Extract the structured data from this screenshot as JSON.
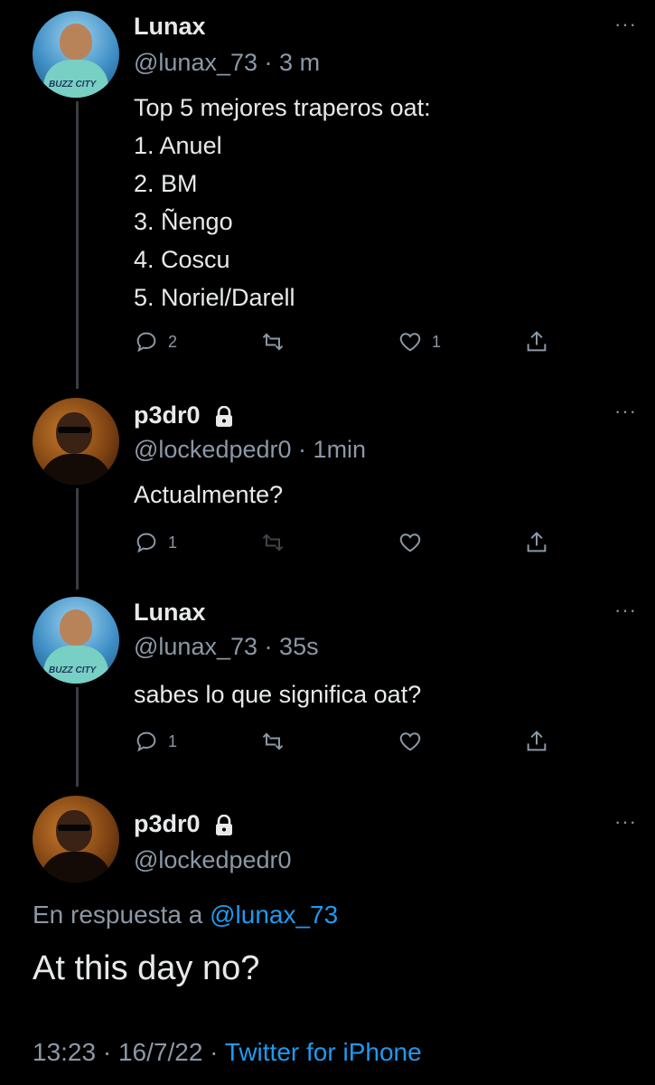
{
  "tweets": [
    {
      "name": "Lunax",
      "handle": "@lunax_73",
      "time": "3 m",
      "body_lines": [
        "Top 5 mejores traperos oat:",
        "1. Anuel",
        "2. BM",
        "3. Ñengo",
        "4. Coscu",
        "5. Noriel/Darell"
      ],
      "replies": "2",
      "retweets": "",
      "likes": "1",
      "avatar_jersey": "BUZZ CITY"
    },
    {
      "name": "p3dr0",
      "handle": "@lockedpedr0",
      "time": "1min",
      "locked": true,
      "body_lines": [
        "Actualmente?"
      ],
      "replies": "1",
      "retweets": "",
      "likes": ""
    },
    {
      "name": "Lunax",
      "handle": "@lunax_73",
      "time": "35s",
      "body_lines": [
        "sabes lo que significa oat?"
      ],
      "replies": "1",
      "retweets": "",
      "likes": "",
      "avatar_jersey": "BUZZ CITY"
    }
  ],
  "main_tweet": {
    "name": "p3dr0",
    "handle": "@lockedpedr0",
    "locked": true,
    "reply_prefix": "En respuesta a",
    "reply_mention": "@lunax_73",
    "text": "At this day no?",
    "time": "13:23",
    "date": "16/7/22",
    "source": "Twitter for iPhone"
  },
  "colors": {
    "background": "#000000",
    "text": "#e7e9ea",
    "secondary": "#8b98a5",
    "link": "#1d9bf0"
  },
  "icons": [
    "reply-icon",
    "retweet-icon",
    "like-icon",
    "share-icon",
    "lock-icon",
    "more-icon"
  ],
  "ui": {
    "more": "···",
    "sep": "·"
  }
}
